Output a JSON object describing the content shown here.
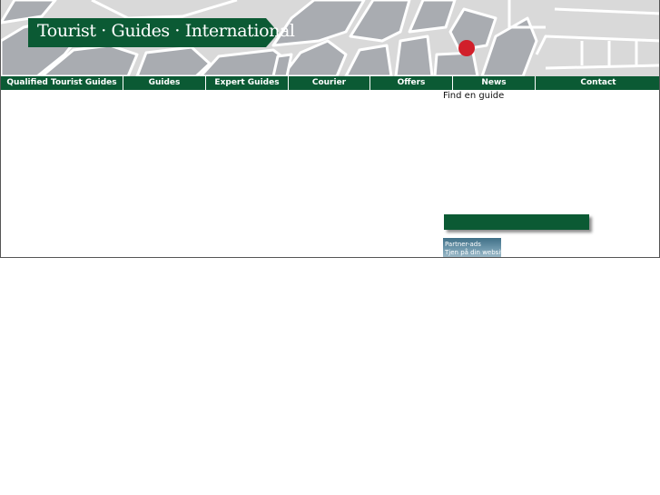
{
  "header": {
    "title": "Tourist · Guides · International",
    "colors": {
      "brand_green": "#0b5a34",
      "map_block": "#a9acb1",
      "map_bg": "#d9d9d9",
      "marker": "#d11f2a"
    }
  },
  "nav": {
    "items": [
      {
        "label": "Qualified Tourist Guides"
      },
      {
        "label": "Guides"
      },
      {
        "label": "Expert Guides"
      },
      {
        "label": "Courier"
      },
      {
        "label": "Offers"
      },
      {
        "label": "News"
      },
      {
        "label": "Contact"
      }
    ]
  },
  "sidebar": {
    "find_guide_label": "Find en guide",
    "partner_ad": {
      "line1": "Partner-ads",
      "line2": "Tjen på din website?"
    }
  }
}
